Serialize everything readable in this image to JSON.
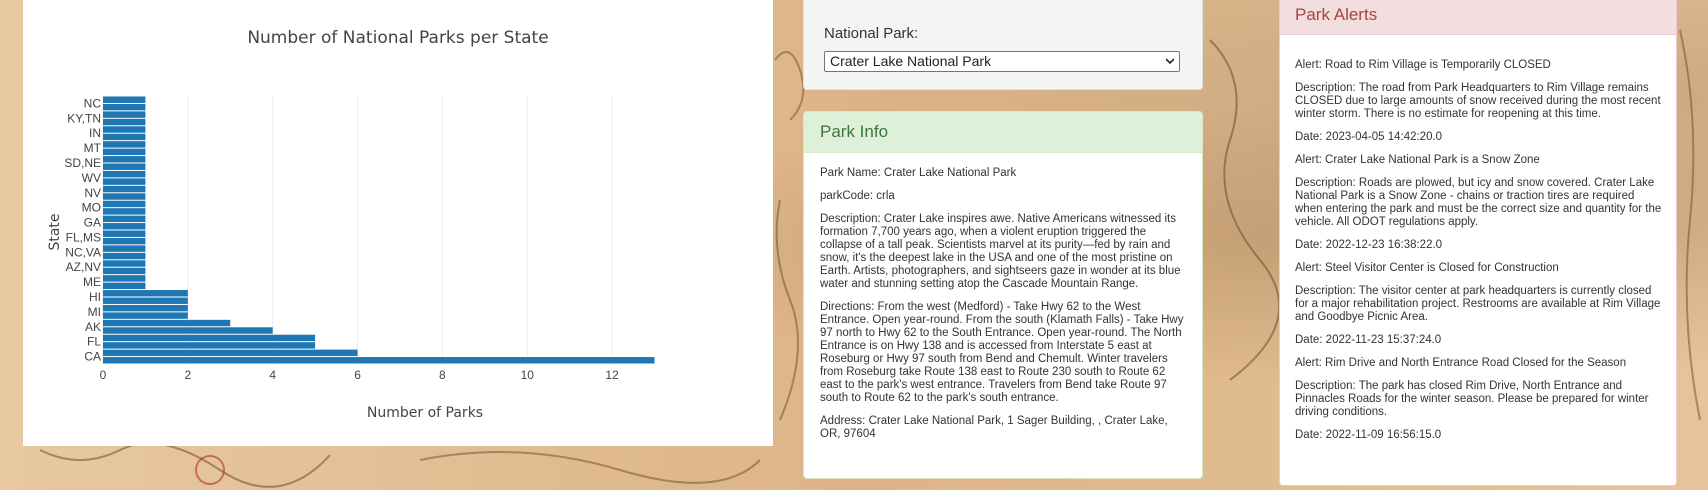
{
  "chart_data": {
    "type": "bar",
    "orientation": "horizontal",
    "title": "Number of National Parks per State",
    "xlabel": "Number of Parks",
    "ylabel": "State",
    "xlim": [
      0,
      13.2
    ],
    "xticks": [
      0,
      2,
      4,
      6,
      8,
      10,
      12
    ],
    "grid": true,
    "color": "#1f77b4",
    "visible_tick_labels": [
      "CA",
      "FL",
      "AK",
      "MI",
      "HI",
      "ME",
      "AZ,NV",
      "NC,VA",
      "FL,MS",
      "GA",
      "MO",
      "NV",
      "WV",
      "SD,NE",
      "MT",
      "IN",
      "KY,TN",
      "NC"
    ],
    "values": [
      13,
      6,
      5,
      5,
      4,
      3,
      2,
      2,
      2,
      2,
      1,
      1,
      1,
      1,
      1,
      1,
      1,
      1,
      1,
      1,
      1,
      1,
      1,
      1,
      1,
      1,
      1,
      1,
      1,
      1,
      1,
      1,
      1,
      1,
      1,
      1
    ]
  },
  "selector": {
    "label": "National Park:",
    "selected": "Crater Lake National Park"
  },
  "park_info": {
    "heading": "Park Info",
    "name": "Park Name: Crater Lake National Park",
    "code": "parkCode: crla",
    "description": "Description: Crater Lake inspires awe. Native Americans witnessed its formation 7,700 years ago, when a violent eruption triggered the collapse of a tall peak. Scientists marvel at its purity—fed by rain and snow, it's the deepest lake in the USA and one of the most pristine on Earth. Artists, photographers, and sightseers gaze in wonder at its blue water and stunning setting atop the Cascade Mountain Range.",
    "directions": "Directions: From the west (Medford) - Take Hwy 62 to the West Entrance. Open year-round. From the south (Klamath Falls) - Take Hwy 97 north to Hwy 62 to the South Entrance. Open year-round. The North Entrance is on Hwy 138 and is accessed from Interstate 5 east at Roseburg or Hwy 97 south from Bend and Chemult. Winter travelers from Roseburg take Route 138 east to Route 230 south to Route 62 east to the park's west entrance. Travelers from Bend take Route 97 south to Route 62 to the park's south entrance.",
    "address": "Address: Crater Lake National Park, 1 Sager Building, , Crater Lake, OR, 97604"
  },
  "alerts": {
    "heading": "Park Alerts",
    "items": [
      {
        "title": "Alert: Road to Rim Village is Temporarily CLOSED",
        "description": "Description: The road from Park Headquarters to Rim Village remains CLOSED due to large amounts of snow received during the most recent winter storm. There is no estimate for reopening at this time.",
        "date": "Date: 2023-04-05 14:42:20.0"
      },
      {
        "title": "Alert: Crater Lake National Park is a Snow Zone",
        "description": "Description: Roads are plowed, but icy and snow covered. Crater Lake National Park is a Snow Zone - chains or traction tires are required when entering the park and must be the correct size and quantity for the vehicle. All ODOT regulations apply.",
        "date": "Date: 2022-12-23 16:38:22.0"
      },
      {
        "title": "Alert: Steel Visitor Center is Closed for Construction",
        "description": "Description: The visitor center at park headquarters is currently closed for a major rehabilitation project. Restrooms are available at Rim Village and Goodbye Picnic Area.",
        "date": "Date: 2022-11-23 15:37:24.0"
      },
      {
        "title": "Alert: Rim Drive and North Entrance Road Closed for the Season",
        "description": "Description: The park has closed Rim Drive, North Entrance and Pinnacles Roads for the winter season. Please be prepared for winter driving conditions.",
        "date": "Date: 2022-11-09 16:56:15.0"
      }
    ]
  }
}
